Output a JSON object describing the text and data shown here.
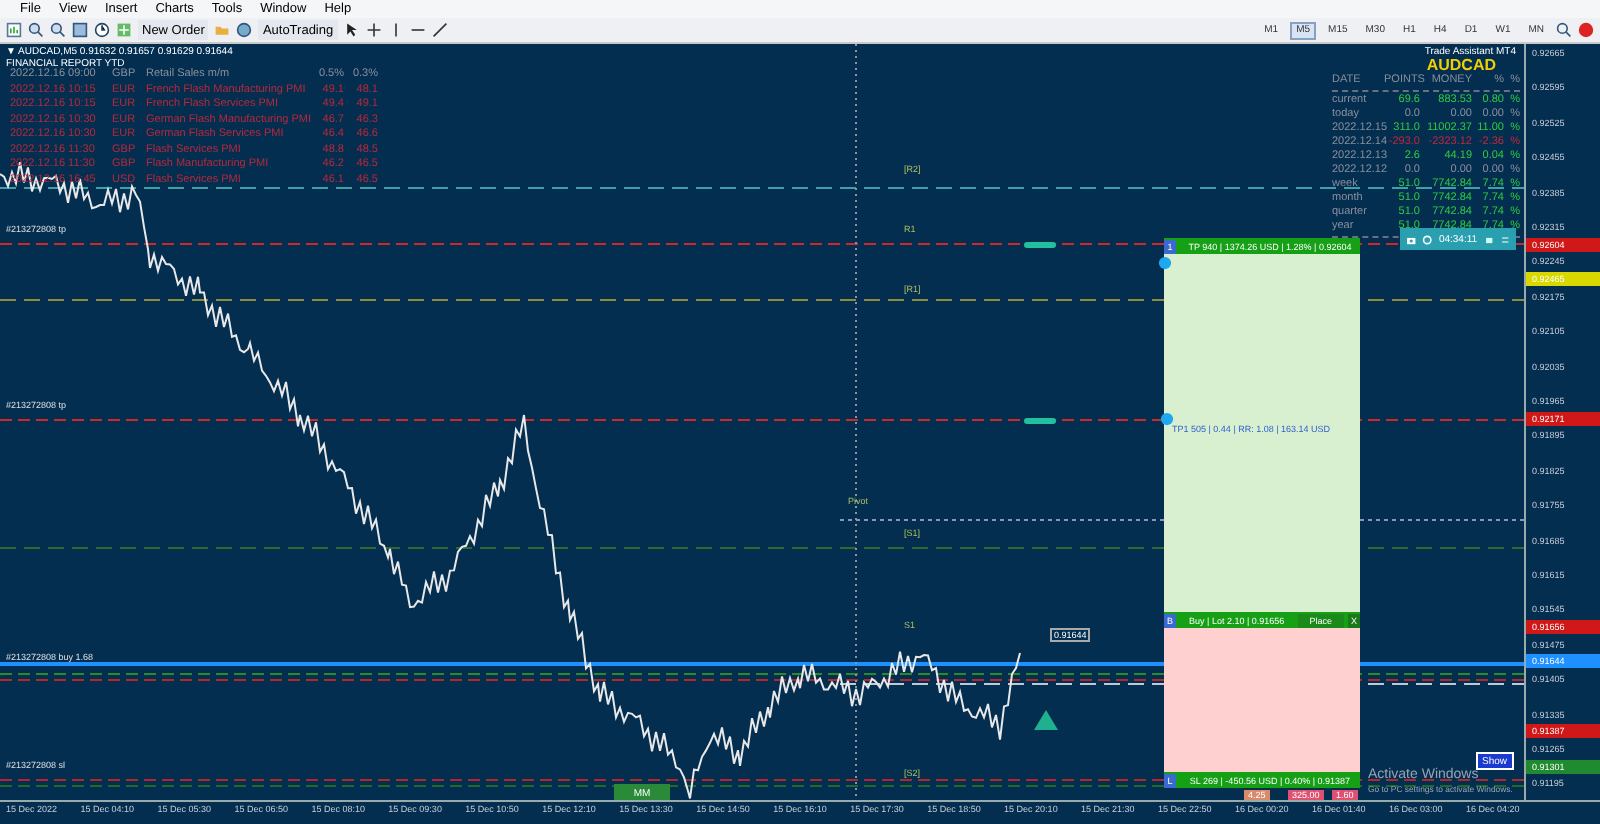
{
  "menu": [
    "File",
    "View",
    "Insert",
    "Charts",
    "Tools",
    "Window",
    "Help"
  ],
  "toolbar": {
    "buttons": [
      {
        "label": "New Order"
      },
      {
        "label": "AutoTrading"
      }
    ],
    "timeframes": [
      {
        "label": "M1",
        "selected": false
      },
      {
        "label": "M5",
        "selected": true
      },
      {
        "label": "M15",
        "selected": false
      },
      {
        "label": "M30",
        "selected": false
      },
      {
        "label": "H1",
        "selected": false
      },
      {
        "label": "H4",
        "selected": false
      },
      {
        "label": "D1",
        "selected": false
      },
      {
        "label": "W1",
        "selected": false
      },
      {
        "label": "MN",
        "selected": false
      }
    ]
  },
  "chart": {
    "symbol_line": "▼ AUDCAD,M5  0.91632 0.91657 0.91629 0.91644",
    "report_title": "FINANCIAL REPORT YTD",
    "assistant_title": "Trade Assistant MT4",
    "news": [
      {
        "time": "2022.12.16 09:00",
        "currency": "GBP",
        "event": "Retail Sales m/m",
        "forecast": "0.5%",
        "previous": "0.3%",
        "color": "#8a8f9c"
      },
      {
        "time": "2022.12.16 10:15",
        "currency": "EUR",
        "event": "French Flash Manufacturing PMI",
        "forecast": "49.1",
        "previous": "48.1",
        "color": "#b8283a"
      },
      {
        "time": "2022.12.16 10:15",
        "currency": "EUR",
        "event": "French Flash Services PMI",
        "forecast": "49.4",
        "previous": "49.1",
        "color": "#b8283a"
      },
      {
        "time": "2022.12.16 10:30",
        "currency": "EUR",
        "event": "German Flash Manufacturing PMI",
        "forecast": "46.7",
        "previous": "46.3",
        "color": "#b8283a"
      },
      {
        "time": "2022.12.16 10:30",
        "currency": "EUR",
        "event": "German Flash Services PMI",
        "forecast": "46.4",
        "previous": "46.6",
        "color": "#b8283a"
      },
      {
        "time": "2022.12.16 11:30",
        "currency": "GBP",
        "event": "Flash Services PMI",
        "forecast": "48.8",
        "previous": "48.5",
        "color": "#b8283a"
      },
      {
        "time": "2022.12.16 11:30",
        "currency": "GBP",
        "event": "Flash Manufacturing PMI",
        "forecast": "46.2",
        "previous": "46.5",
        "color": "#b8283a"
      },
      {
        "time": "2022.12.16 16:45",
        "currency": "USD",
        "event": "Flash Services PMI",
        "forecast": "46.1",
        "previous": "46.5",
        "color": "#b8283a"
      }
    ],
    "order_labels": [
      "#213272808 tp",
      "#213272808 tp",
      "#213272808 buy 1.68",
      "#213272808 sl"
    ],
    "level_labels": [
      "[R2]",
      "R1",
      "[R1]",
      "Pivot",
      "[S1]",
      "S1",
      "[S2]"
    ],
    "stats": {
      "symbol": "AUDCAD",
      "columns": [
        "DATE",
        "POINTS",
        "MONEY",
        "%",
        "%"
      ],
      "rows": [
        {
          "date": "current",
          "points": "69.6",
          "money": "883.53",
          "pct": "0.80",
          "unit": "%",
          "color": "#2ecc40"
        },
        {
          "date": "today",
          "points": "0.0",
          "money": "0.00",
          "pct": "0.00",
          "unit": "%",
          "color": "#8a8f9c"
        },
        {
          "date": "2022.12.15",
          "points": "311.0",
          "money": "11002.37",
          "pct": "11.00",
          "unit": "%",
          "color": "#2ecc40"
        },
        {
          "date": "2022.12.14",
          "points": "-293.0",
          "money": "-2323.12",
          "pct": "-2.36",
          "unit": "%",
          "color": "#c0283a"
        },
        {
          "date": "2022.12.13",
          "points": "2.6",
          "money": "44.19",
          "pct": "0.04",
          "unit": "%",
          "color": "#2ecc40"
        },
        {
          "date": "2022.12.12",
          "points": "0.0",
          "money": "0.00",
          "pct": "0.00",
          "unit": "%",
          "color": "#8a8f9c"
        },
        {
          "date": "week",
          "points": "51.0",
          "money": "7742.84",
          "pct": "7.74",
          "unit": "%",
          "color": "#2ecc40"
        },
        {
          "date": "month",
          "points": "51.0",
          "money": "7742.84",
          "pct": "7.74",
          "unit": "%",
          "color": "#2ecc40"
        },
        {
          "date": "quarter",
          "points": "51.0",
          "money": "7742.84",
          "pct": "7.74",
          "unit": "%",
          "color": "#2ecc40"
        },
        {
          "date": "year",
          "points": "51.0",
          "money": "7742.84",
          "pct": "7.74",
          "unit": "%",
          "color": "#2ecc40"
        }
      ]
    }
  },
  "clock": "04:34:11",
  "trade": {
    "tp_tag": "1",
    "tp_bar": "TP 940 | 1374.26 USD | 1.28% | 0.92604",
    "tp1_line": "TP1 505 | 0.44 | RR: 1.08 | 163.14 USD",
    "b_tag": "B",
    "order_info": "Buy | Lot 2.10 | 0.91656",
    "place": "Place",
    "close": "X",
    "l_tag": "L",
    "sl_bar": "SL 269 | -450.56 USD | 0.40% | 0.91387"
  },
  "price_flag": "0.91644",
  "mm_button": "MM",
  "show_button": "Show",
  "bottom_badges": [
    {
      "text": "4.25",
      "color": "#d98a6a"
    },
    {
      "text": "325.00",
      "color": "#e05070"
    },
    {
      "text": "1.60",
      "color": "#e05070"
    }
  ],
  "os_notice": {
    "title": "Activate Windows",
    "subtitle": "Go to PC settings to activate Windows."
  },
  "price_axis": [
    "0.92665",
    "0.92595",
    "0.92525",
    "0.92455",
    "0.92385",
    "0.92315",
    "0.92245",
    "0.92175",
    "0.92105",
    "0.92035",
    "0.91965",
    "0.91895",
    "0.91825",
    "0.91755",
    "0.91685",
    "0.91615",
    "0.91545",
    "0.91475",
    "0.91405",
    "0.91335",
    "0.91265",
    "0.91195"
  ],
  "axis_tags": [
    {
      "text": "0.92604",
      "color": "#d01818"
    },
    {
      "text": "0.92465",
      "color": "#d8d800"
    },
    {
      "text": "0.92171",
      "color": "#d01818"
    },
    {
      "text": "0.91656",
      "color": "#d01818"
    },
    {
      "text": "0.91644",
      "color": "#1e90ff"
    },
    {
      "text": "0.91387",
      "color": "#d01818"
    },
    {
      "text": "0.91301",
      "color": "#208a30"
    }
  ],
  "time_axis": [
    "15 Dec 2022",
    "15 Dec 04:10",
    "15 Dec 05:30",
    "15 Dec 06:50",
    "15 Dec 08:10",
    "15 Dec 09:30",
    "15 Dec 10:50",
    "15 Dec 12:10",
    "15 Dec 13:30",
    "15 Dec 14:50",
    "15 Dec 16:10",
    "15 Dec 17:30",
    "15 Dec 18:50",
    "15 Dec 20:10",
    "15 Dec 21:30",
    "15 Dec 22:50",
    "16 Dec 00:20",
    "16 Dec 01:40",
    "16 Dec 03:00",
    "16 Dec 04:20"
  ]
}
